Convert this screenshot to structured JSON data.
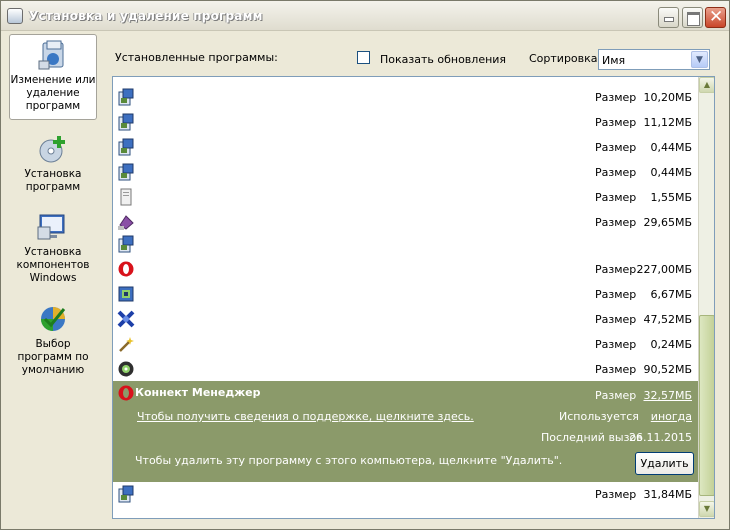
{
  "window": {
    "title": "Установка и удаление программ",
    "close_glyph": "✕"
  },
  "sidebar": {
    "items": [
      {
        "label": "Изменение или удаление программ",
        "icon": "change-remove-programs-icon",
        "selected": true
      },
      {
        "label": "Установка программ",
        "icon": "add-programs-icon"
      },
      {
        "label": "Установка компонентов Windows",
        "icon": "windows-components-icon"
      },
      {
        "label": "Выбор программ по умолчанию",
        "icon": "default-programs-icon"
      }
    ]
  },
  "toolbar": {
    "installed_label": "Установленные программы:",
    "show_updates_label": "Показать обновления",
    "sort_label": "Сортировка:",
    "sort_value": "Имя",
    "sort_arrow": "▼"
  },
  "list": {
    "rows": [
      {
        "icon": "installer-icon",
        "size_label": "Размер",
        "size": "10,20МБ"
      },
      {
        "icon": "installer-icon",
        "size_label": "Размер",
        "size": "11,12МБ"
      },
      {
        "icon": "installer-icon",
        "size_label": "Размер",
        "size": "0,44МБ"
      },
      {
        "icon": "installer-icon",
        "size_label": "Размер",
        "size": "0,44МБ"
      },
      {
        "icon": "file-icon",
        "size_label": "Размер",
        "size": "1,55МБ"
      },
      {
        "icon": "pen-tool-icon",
        "size_label": "Размер",
        "size": "29,65МБ"
      },
      {
        "icon": "installer-icon",
        "size_label": "",
        "size": ""
      },
      {
        "icon": "opera-icon",
        "size_label": "Размер",
        "size": "227,00МБ"
      },
      {
        "icon": "setup-icon",
        "size_label": "Размер",
        "size": "6,67МБ"
      },
      {
        "icon": "blue-app-icon",
        "size_label": "Размер",
        "size": "47,52МБ"
      },
      {
        "icon": "wand-icon",
        "size_label": "Размер",
        "size": "0,24МБ"
      },
      {
        "icon": "disc-icon",
        "size_label": "Размер",
        "size": "90,52МБ"
      }
    ],
    "selected": {
      "name": "Коннект Менеджер",
      "size_label": "Размер",
      "size": "32,57МБ",
      "support_link": "Чтобы получить сведения о поддержке, щелкните здесь.",
      "used_label": "Используется",
      "used_value": "иногда",
      "last_used_label": "Последний вызов",
      "last_used_value": "26.11.2015",
      "remove_hint": "Чтобы удалить эту программу с этого компьютера, щелкните \"Удалить\".",
      "remove_button": "Удалить"
    },
    "last_row": {
      "icon": "installer-icon",
      "size_label": "Размер",
      "size": "31,84МБ"
    },
    "scroll_up": "▲",
    "scroll_down": "▼"
  }
}
